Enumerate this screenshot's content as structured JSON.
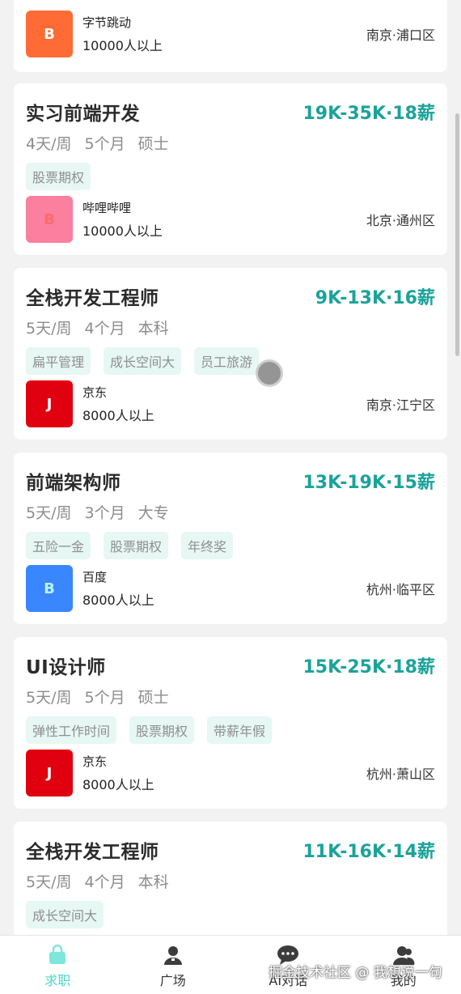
{
  "colors": {
    "accent": "#1aa39a",
    "tag_bg": "#e6f7f4",
    "tab_active": "#46d9c9"
  },
  "partial_card": {
    "company": {
      "logo": "B",
      "logo_color": "#ff6b35",
      "name": "字节跳动",
      "size": "10000人以上",
      "location": "南京·浦口区"
    }
  },
  "jobs": [
    {
      "title": "实习前端开发",
      "salary": "19K-35K·18薪",
      "requirements": [
        "4天/周",
        "5个月",
        "硕士"
      ],
      "tags": [
        "股票期权"
      ],
      "company": {
        "logo": "B",
        "logo_color": "#fb7f9e",
        "logo_text_color": "#ff6b6b",
        "name": "哔哩哔哩",
        "size": "10000人以上",
        "location": "北京·通州区"
      }
    },
    {
      "title": "全栈开发工程师",
      "salary": "9K-13K·16薪",
      "requirements": [
        "5天/周",
        "4个月",
        "本科"
      ],
      "tags": [
        "扁平管理",
        "成长空间大",
        "员工旅游"
      ],
      "company": {
        "logo": "J",
        "logo_color": "#e1000f",
        "name": "京东",
        "size": "8000人以上",
        "location": "南京·江宁区"
      }
    },
    {
      "title": "前端架构师",
      "salary": "13K-19K·15薪",
      "requirements": [
        "5天/周",
        "3个月",
        "大专"
      ],
      "tags": [
        "五险一金",
        "股票期权",
        "年终奖"
      ],
      "company": {
        "logo": "B",
        "logo_color": "#3a86ff",
        "logo_text_color": "#b8f4ee",
        "name": "百度",
        "size": "8000人以上",
        "location": "杭州·临平区"
      }
    },
    {
      "title": "UI设计师",
      "salary": "15K-25K·18薪",
      "requirements": [
        "5天/周",
        "5个月",
        "硕士"
      ],
      "tags": [
        "弹性工作时间",
        "股票期权",
        "带薪年假"
      ],
      "company": {
        "logo": "J",
        "logo_color": "#e1000f",
        "name": "京东",
        "size": "8000人以上",
        "location": "杭州·萧山区"
      }
    },
    {
      "title": "全栈开发工程师",
      "salary": "11K-16K·14薪",
      "requirements": [
        "5天/周",
        "4个月",
        "本科"
      ],
      "tags": [
        "成长空间大"
      ]
    }
  ],
  "tabbar": {
    "items": [
      {
        "label": "求职",
        "icon": "briefcase-icon",
        "active": true
      },
      {
        "label": "广场",
        "icon": "person-icon",
        "active": false
      },
      {
        "label": "AI对话",
        "icon": "chat-icon",
        "active": false
      },
      {
        "label": "我的",
        "icon": "people-icon",
        "active": false
      }
    ]
  },
  "watermark": "掘金技术社区 @ 我想说一句"
}
